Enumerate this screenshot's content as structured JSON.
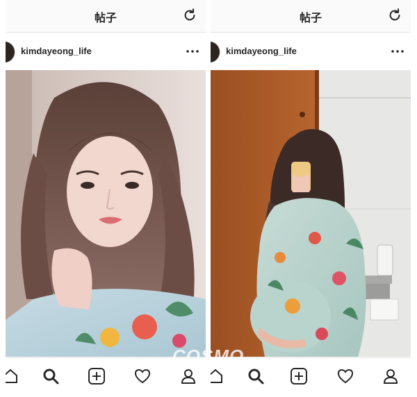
{
  "panels": [
    {
      "topbar": {
        "title": "帖子",
        "refresh_icon": "refresh-icon"
      },
      "post": {
        "username": "kimdayeong_life",
        "more_icon": "more-icon"
      },
      "tabbar": {
        "items": [
          "home-icon",
          "search-icon",
          "add-icon",
          "heart-icon",
          "profile-icon"
        ]
      }
    },
    {
      "topbar": {
        "title": "帖子",
        "refresh_icon": "refresh-icon"
      },
      "post": {
        "username": "kimdayeong_life",
        "more_icon": "more-icon"
      },
      "tabbar": {
        "items": [
          "home-icon",
          "search-icon",
          "add-icon",
          "heart-icon",
          "profile-icon"
        ]
      }
    }
  ],
  "watermark": "COSMO",
  "colors": {
    "bar_background": "#fafafa",
    "text": "#262626",
    "divider": "#e3e3e3"
  }
}
